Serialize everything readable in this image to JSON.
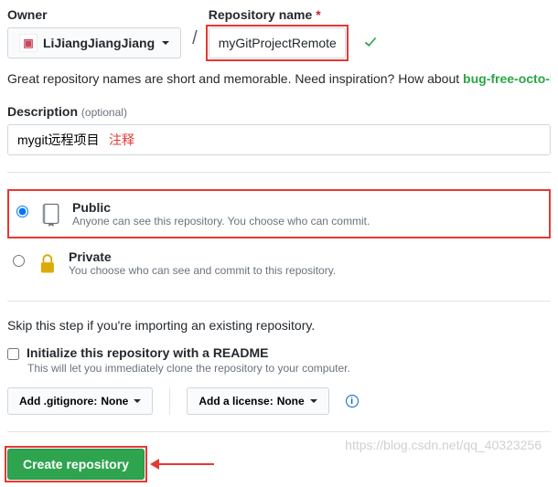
{
  "owner": {
    "label": "Owner",
    "name": "LiJiangJiangJiang"
  },
  "repo": {
    "label": "Repository name",
    "value": "myGitProjectRemote"
  },
  "help": {
    "prefix": "Great repository names are short and memorable. Need inspiration? How about ",
    "suggestion": "bug-free-octo-in"
  },
  "description": {
    "label": "Description",
    "optional": "(optional)",
    "value": "mygit远程项目",
    "annotation": "注释"
  },
  "visibility": {
    "public": {
      "title": "Public",
      "desc": "Anyone can see this repository. You choose who can commit."
    },
    "private": {
      "title": "Private",
      "desc": "You choose who can see and commit to this repository."
    }
  },
  "skip_text": "Skip this step if you're importing an existing repository.",
  "readme": {
    "label": "Initialize this repository with a README",
    "note": "This will let you immediately clone the repository to your computer."
  },
  "gitignore": {
    "prefix": "Add .gitignore: ",
    "value": "None"
  },
  "license": {
    "prefix": "Add a license: ",
    "value": "None"
  },
  "create_label": "Create repository",
  "watermark": "https://blog.csdn.net/qq_40323256"
}
